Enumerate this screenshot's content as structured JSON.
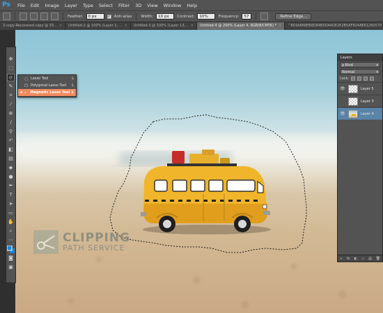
{
  "app": {
    "logo": "Ps"
  },
  "menu": [
    "File",
    "Edit",
    "Image",
    "Layer",
    "Type",
    "Select",
    "Filter",
    "3D",
    "View",
    "Window",
    "Help"
  ],
  "options": {
    "feather_label": "Feather:",
    "feather_value": "0 px",
    "antialias_label": "Anti-alias",
    "antialias_checked": "✓",
    "width_label": "Width:",
    "width_value": "10 px",
    "contrast_label": "Contrast:",
    "contrast_value": "10%",
    "frequency_label": "Frequency:",
    "frequency_value": "57",
    "refine_edge": "Refine Edge..."
  },
  "tabs": [
    {
      "label": "2-copy-Recovered copy @ 33...",
      "close": "×"
    },
    {
      "label": "Untitled-2 @ 100% (Layer 1, ...",
      "close": "×"
    },
    {
      "label": "Untitled-3 @ 100% (Layer 13,...",
      "close": "×"
    },
    {
      "label": "Untitled-4 @ 200% (Layer 4, RGB/8/CMYK) *",
      "close": "×"
    },
    {
      "label": "^803A868EB8D84B5DA4DE262B5AF824AE61260570",
      "close": ""
    }
  ],
  "lasso_menu": {
    "items": [
      {
        "bullet": "",
        "icon": "◌",
        "name": "Lasso Tool",
        "key": "L"
      },
      {
        "bullet": "",
        "icon": "⬠",
        "name": "Polygonal Lasso Tool",
        "key": "L"
      },
      {
        "bullet": "▪",
        "icon": "⌁",
        "name": "Magnetic Lasso Tool",
        "key": "L"
      }
    ]
  },
  "layers_panel": {
    "title": "Layers",
    "filter": "ρ Kind",
    "blend_mode": "Normal",
    "lock_label": "Lock:",
    "layers": [
      {
        "name": "Layer 5",
        "visible": "👁"
      },
      {
        "name": "Layer 3",
        "visible": ""
      },
      {
        "name": "Layer 4",
        "visible": "👁"
      }
    ],
    "footer_icons": [
      "∞",
      "fx",
      "◐",
      "▭",
      "▤",
      "🗑"
    ]
  },
  "watermark": {
    "line1": "CLIPPING",
    "line2": "PATH SERVICE"
  }
}
